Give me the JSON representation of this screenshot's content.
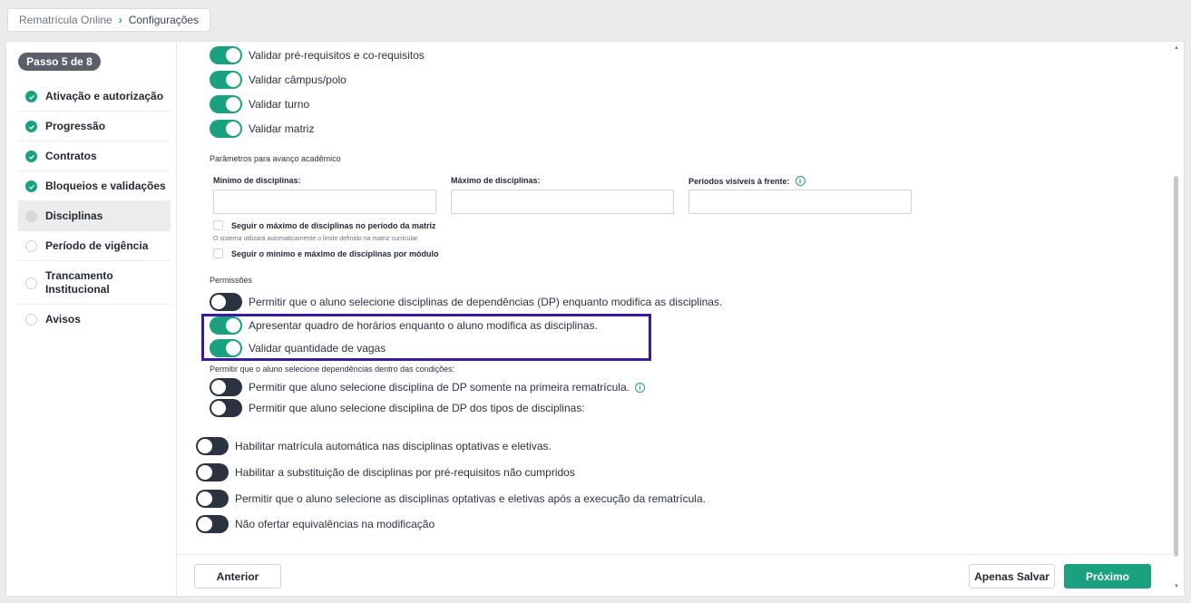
{
  "breadcrumb": {
    "root": "Rematrícula Online",
    "separator": "›",
    "current": "Configurações"
  },
  "sidebar": {
    "step_label": "Passo 5 de 8",
    "items": [
      {
        "label": "Ativação e autorização",
        "state": "done"
      },
      {
        "label": "Progressão",
        "state": "done"
      },
      {
        "label": "Contratos",
        "state": "done"
      },
      {
        "label": "Bloqueios e validações",
        "state": "done"
      },
      {
        "label": "Disciplinas",
        "state": "current"
      },
      {
        "label": "Período de vigência",
        "state": "todo"
      },
      {
        "label": "Trancamento Institucional",
        "state": "todo"
      },
      {
        "label": "Avisos",
        "state": "todo"
      }
    ]
  },
  "validations": [
    {
      "label": "Validar pré-requisitos e co-requisitos",
      "on": true
    },
    {
      "label": "Validar câmpus/polo",
      "on": true
    },
    {
      "label": "Validar turno",
      "on": true
    },
    {
      "label": "Validar matriz",
      "on": true
    }
  ],
  "academic": {
    "title": "Parâmetros para avanço acadêmico",
    "min_label": "Mínimo de disciplinas:",
    "max_label": "Máximo de disciplinas:",
    "periods_label": "Períodos visíveis à frente:",
    "min_value": "",
    "max_value": "",
    "periods_value": "",
    "check_max_label": "Seguir o máximo de disciplinas no período da matriz",
    "check_max_hint": "O sistema utilizará automaticamente o limite definido na matriz curricular.",
    "check_module_label": "Seguir o mínimo e máximo de disciplinas por módulo"
  },
  "permissions": {
    "title": "Permissões",
    "items": [
      {
        "label": "Permitir que o aluno selecione disciplinas de dependências (DP) enquanto modifica as disciplinas.",
        "on": false
      },
      {
        "label": "Apresentar quadro de horários enquanto o aluno modifica as disciplinas.",
        "on": true
      },
      {
        "label": "Validar quantidade de vagas",
        "on": true
      }
    ],
    "conditions_title": "Permitir que o aluno selecione dependências dentro das condições:",
    "conditions": [
      {
        "label": "Permitir que aluno selecione disciplina de DP somente na primeira rematrícula.",
        "on": false
      },
      {
        "label": "Permitir que aluno selecione disciplina de DP dos tipos de disciplinas:",
        "on": false
      }
    ]
  },
  "general": [
    {
      "label": "Habilitar matrícula automática nas disciplinas optativas e eletivas.",
      "on": false
    },
    {
      "label": "Habilitar a substituição de disciplinas por pré-requisitos não cumpridos",
      "on": false
    },
    {
      "label": "Permitir que o aluno selecione as disciplinas optativas e eletivas após a execução da rematrícula.",
      "on": false
    },
    {
      "label": "Não ofertar equivalências na modificação",
      "on": false
    }
  ],
  "footer": {
    "prev": "Anterior",
    "save": "Apenas Salvar",
    "next": "Próximo"
  },
  "colors": {
    "accent": "#1aa280",
    "toggle_off": "#2b3340",
    "highlight": "#3a1aa0"
  }
}
